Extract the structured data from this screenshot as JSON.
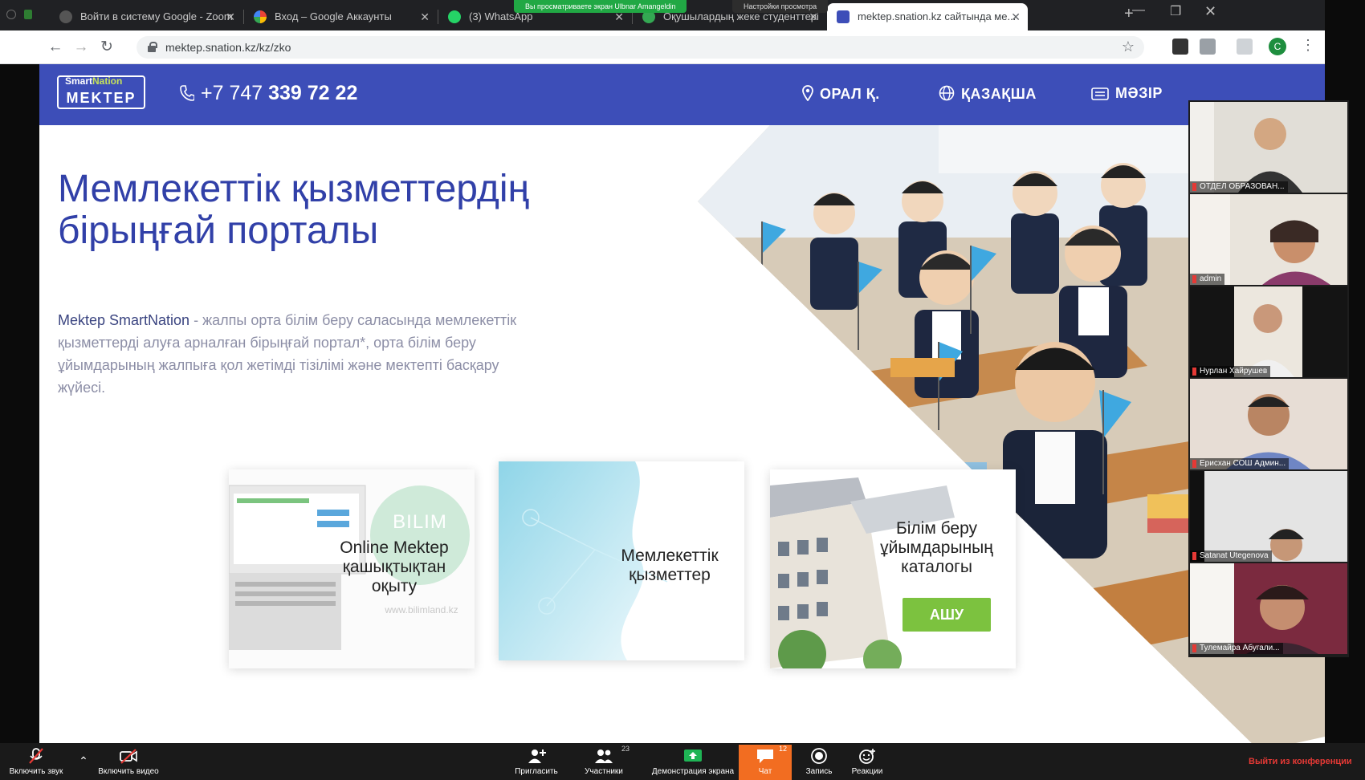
{
  "browser": {
    "tabs": [
      {
        "label": "Войти в систему Google - Zoom"
      },
      {
        "label": "Вход – Google Аккаунты"
      },
      {
        "label": "(3) WhatsApp"
      },
      {
        "label": "Оқушылардың жеке студенттері"
      },
      {
        "label": "mektep.snation.kz сайтында ме..."
      }
    ],
    "url": "mektep.snation.kz/kz/zko",
    "profile_initial": "C"
  },
  "zoom_overlay": {
    "share_banner": "Вы просматриваете экран Ulbnar Amangeldin",
    "share_settings": "Настройки просмотра"
  },
  "site": {
    "logo_small_smart": "Smart",
    "logo_small_nation": "Nation",
    "logo_main": "MEKTEP",
    "phone_prefix": "+7 747",
    "phone_number": "339 72 22",
    "region": "ОРАЛ Қ.",
    "language": "ҚАЗАҚША",
    "menu": "МӘЗІР",
    "hero_title": "Мемлекеттік қызметтердің бірыңғай порталы",
    "hero_desc_brand": "Mektep SmartNation",
    "hero_desc_rest": " - жалпы орта білім беру саласында мемлекеттік қызметтерді алуға арналған бірыңғай портал*, орта білім беру ұйымдарының жалпыға қол жетімді тізілімі және мектепті басқару жүйесі.",
    "cards": [
      {
        "title": "Online Mektep қашықтықтан оқыту",
        "badge": "BILIM",
        "site": "www.bilimland.kz"
      },
      {
        "title": "Мемлекеттік қызметтер"
      },
      {
        "title": "Білім беру ұйымдарының каталогы",
        "button": "АШУ"
      }
    ]
  },
  "participants": [
    {
      "name": "ОТДЕЛ ОБРАЗОВАН..."
    },
    {
      "name": "admin"
    },
    {
      "name": "Нурлан Хайрушев"
    },
    {
      "name": "Ерисхан СОШ Админ..."
    },
    {
      "name": "Satanat Utegenova"
    },
    {
      "name": "Тулемайра Абугали..."
    }
  ],
  "zoom_bar": {
    "mute": "Включить звук",
    "video": "Включить видео",
    "invite": "Пригласить",
    "participants": "Участники",
    "participants_count": "23",
    "share": "Демонстрация экрана",
    "chat": "Чат",
    "chat_count": "12",
    "record": "Запись",
    "reactions": "Реакции",
    "leave": "Выйти из конференции"
  },
  "colors": {
    "header": "#3d4eb8",
    "title": "#3140a8",
    "button": "#7cc23f",
    "chat": "#f26d21"
  }
}
